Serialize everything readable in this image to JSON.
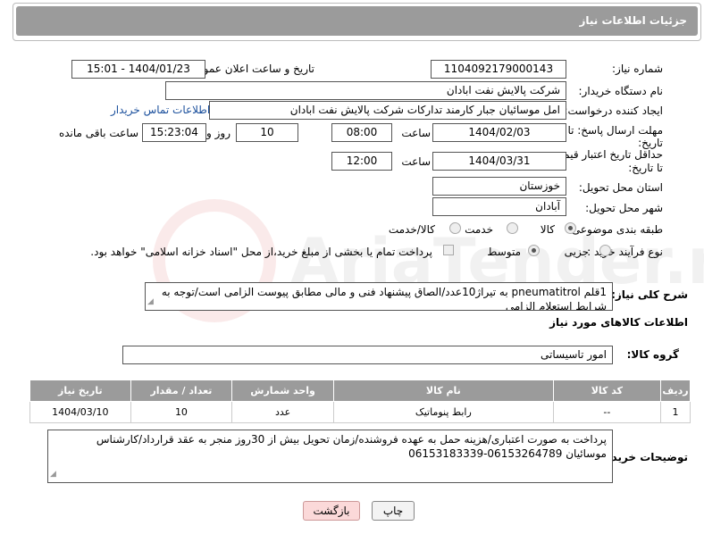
{
  "header": {
    "title": "جزئیات اطلاعات نیاز"
  },
  "form": {
    "need_number_label": "شماره نیاز:",
    "need_number": "1104092179000143",
    "announce_label": "تاریخ و ساعت اعلان عمومی:",
    "announce_value": "1404/01/23 - 15:01",
    "buyer_org_label": "نام دستگاه خریدار:",
    "buyer_org": "شرکت پالایش نفت ابادان",
    "requester_label": "ایجاد کننده درخواست:",
    "requester": "امل موسائیان جبار کارمند تدارکات شرکت پالایش نفت ابادان",
    "contact_link": "اطلاعات تماس خریدار",
    "reply_deadline_label_1": "مهلت ارسال پاسخ: تا",
    "reply_deadline_label_2": "تاریخ:",
    "reply_date": "1404/02/03",
    "time_label": "ساعت",
    "reply_time": "08:00",
    "days_value": "10",
    "days_label": "روز و",
    "remaining_time": "15:23:04",
    "remaining_label": "ساعت باقی مانده",
    "price_valid_label_1": "حداقل تاریخ اعتبار قیمت:",
    "price_valid_label_2": "تا تاریخ:",
    "price_valid_date": "1404/03/31",
    "price_valid_time": "12:00",
    "province_label": "استان محل تحویل:",
    "province": "خوزستان",
    "city_label": "شهر محل تحویل:",
    "city": "آبادان",
    "category_label": "طبقه بندی موضوعی:",
    "category_options": [
      "کالا",
      "خدمت",
      "کالا/خدمت"
    ],
    "category_selected": "کالا",
    "process_label": "نوع فرآیند خرید :",
    "process_options": [
      "جزیی",
      "متوسط"
    ],
    "process_selected": "متوسط",
    "payment_note": "پرداخت تمام یا بخشی از مبلغ خرید،از محل \"اسناد خزانه اسلامی\" خواهد بود."
  },
  "description": {
    "label": "شرح کلی نیاز:",
    "text": "1قلم pneumatitrol به تیراژ10عدد/الصاق پیشنهاد فنی و مالی مطابق پیوست الزامی است/توجه به شرایط استعلام الزامی"
  },
  "goods": {
    "section_title": "اطلاعات کالاهای مورد نیاز",
    "group_label": "گروه کالا:",
    "group_value": "امور تاسیساتی",
    "columns": [
      "ردیف",
      "کد کالا",
      "نام کالا",
      "واحد شمارش",
      "تعداد / مقدار",
      "تاریخ نیاز"
    ],
    "rows": [
      {
        "row": "1",
        "code": "--",
        "name": "رابط پنوماتیک",
        "unit": "عدد",
        "qty": "10",
        "date": "1404/03/10"
      }
    ]
  },
  "buyer_notes": {
    "label": "توضیحات خریدار:",
    "text": "پرداخت به صورت اعتباری/هزینه حمل به عهده فروشنده/زمان تحویل بیش از 30روز منجر به عقد قرارداد/کارشناس موسائیان 06153264789-06153183339"
  },
  "buttons": {
    "print": "چاپ",
    "back": "بازگشت"
  },
  "watermark": {
    "text": "AriaTender.net"
  },
  "colors": {
    "header_bg": "#9b9b9b",
    "link": "#1a4f9c",
    "back_button": "#fbd9d9"
  }
}
